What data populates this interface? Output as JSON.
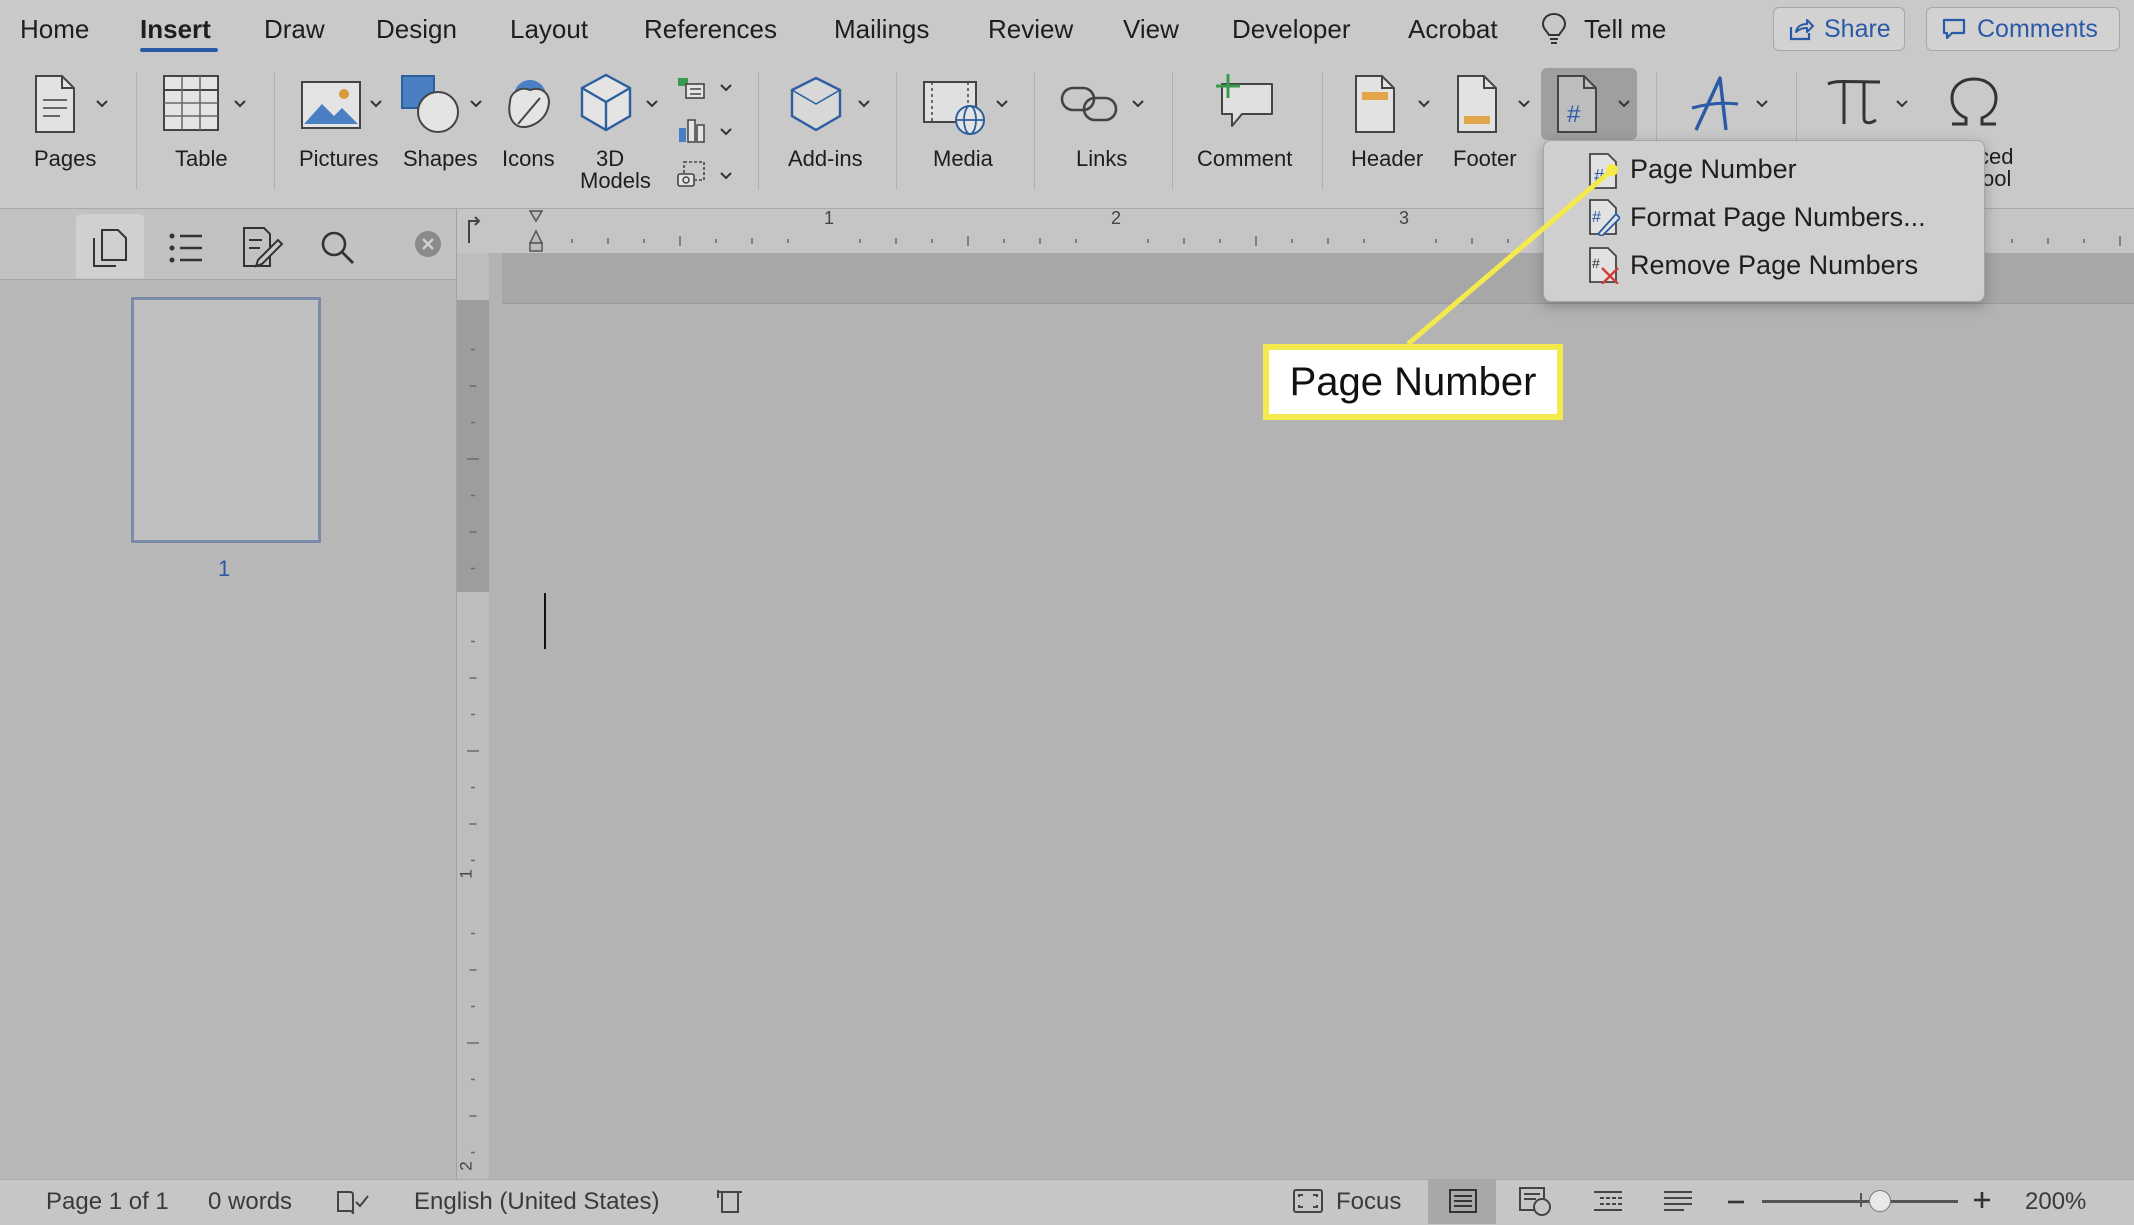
{
  "menu": {
    "tabs": [
      "Home",
      "Insert",
      "Draw",
      "Design",
      "Layout",
      "References",
      "Mailings",
      "Review",
      "View",
      "Developer",
      "Acrobat"
    ],
    "active_tab": "Insert",
    "tell_me": "Tell me",
    "share_label": "Share",
    "comments_label": "Comments"
  },
  "ribbon": {
    "pages": "Pages",
    "table": "Table",
    "pictures": "Pictures",
    "shapes": "Shapes",
    "icons": "Icons",
    "models_line1": "3D",
    "models_line2": "Models",
    "addins": "Add-ins",
    "media": "Media",
    "links": "Links",
    "comment": "Comment",
    "header": "Header",
    "footer": "Footer",
    "symbol_partial_line1": "ced",
    "symbol_partial_line2": "ool"
  },
  "dropdown": {
    "items": [
      "Page Number",
      "Format Page Numbers...",
      "Remove Page Numbers"
    ]
  },
  "callout": {
    "label": "Page Number"
  },
  "nav_pane": {
    "thumbnail_page": "1"
  },
  "ruler": {
    "marks": [
      "1",
      "2",
      "3"
    ]
  },
  "vruler": {
    "marks": [
      "1",
      "1",
      "2"
    ]
  },
  "status_bar": {
    "page": "Page 1 of 1",
    "words": "0 words",
    "language": "English (United States)",
    "focus": "Focus",
    "zoom": "200%"
  },
  "colors": {
    "accent": "#2a5aa6",
    "callout_border": "#f4e94d",
    "background": "#b3b3b3"
  }
}
